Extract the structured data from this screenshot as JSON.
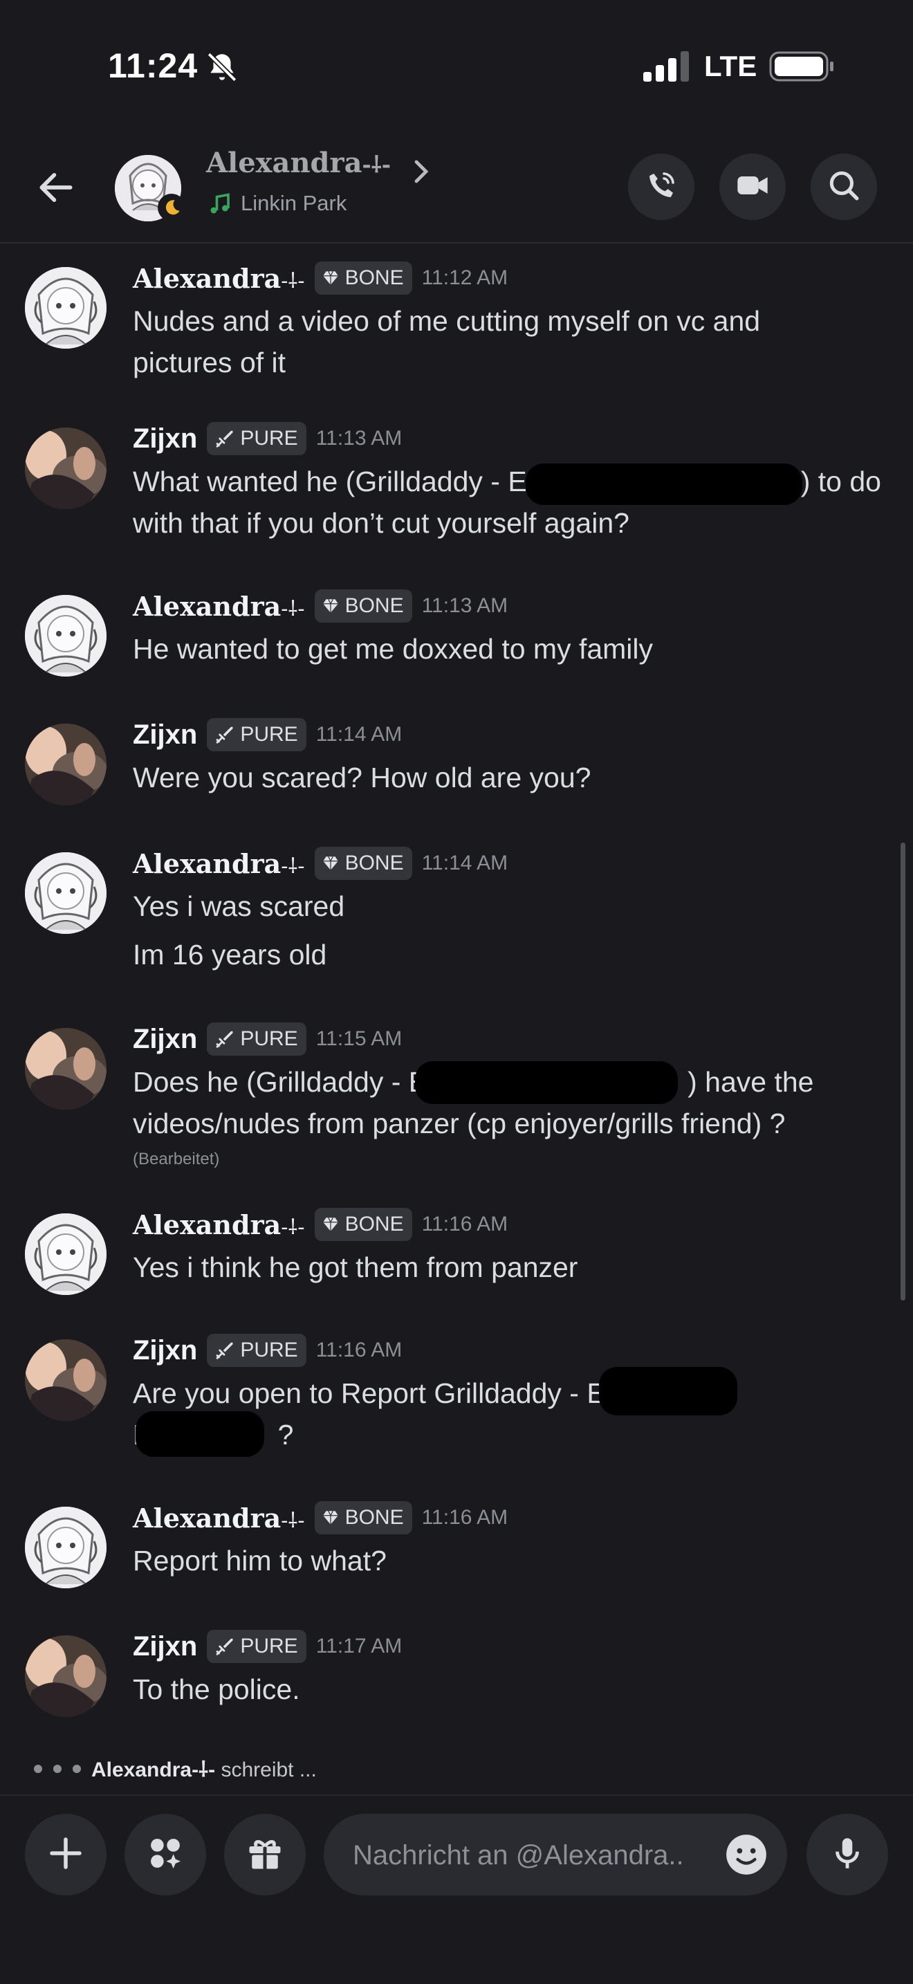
{
  "status_bar": {
    "time": "11:24",
    "network": "LTE"
  },
  "header": {
    "name": "Alexandra",
    "name_suffix": "-⸸-",
    "activity": "Linkin Park"
  },
  "messages": [
    {
      "author": "Alexandra",
      "suffix": "-⸸-",
      "badge": "BONE",
      "time": "11:12 AM",
      "lines": [
        "Nudes and a video of me cutting myself on vc and",
        "pictures of it"
      ]
    },
    {
      "author": "Zijxn",
      "badge": "PURE",
      "time": "11:13 AM",
      "lines": [
        "What wanted he (Grilldaddy - E",
        ") to do",
        "with that if you don’t cut yourself again?"
      ]
    },
    {
      "author": "Alexandra",
      "suffix": "-⸸-",
      "badge": "BONE",
      "time": "11:13 AM",
      "lines": [
        "He wanted to get me doxxed to my family"
      ]
    },
    {
      "author": "Zijxn",
      "badge": "PURE",
      "time": "11:14 AM",
      "lines": [
        "Were you scared? How old are you?"
      ]
    },
    {
      "author": "Alexandra",
      "suffix": "-⸸-",
      "badge": "BONE",
      "time": "11:14 AM",
      "lines": [
        "Yes i was scared",
        "Im 16 years old"
      ]
    },
    {
      "author": "Zijxn",
      "badge": "PURE",
      "time": "11:15 AM",
      "lines": [
        "Does he (Grilldaddy - E",
        ") have the",
        "videos/nudes from panzer (cp enjoyer/grills friend) ?"
      ],
      "edited": "(Bearbeitet)"
    },
    {
      "author": "Alexandra",
      "suffix": "-⸸-",
      "badge": "BONE",
      "time": "11:16 AM",
      "lines": [
        "Yes i think he got them from panzer"
      ]
    },
    {
      "author": "Zijxn",
      "badge": "PURE",
      "time": "11:16 AM",
      "lines": [
        "Are you open to Report Grilldaddy - E",
        "D",
        "?"
      ]
    },
    {
      "author": "Alexandra",
      "suffix": "-⸸-",
      "badge": "BONE",
      "time": "11:16 AM",
      "lines": [
        "Report him to what?"
      ]
    },
    {
      "author": "Zijxn",
      "badge": "PURE",
      "time": "11:17 AM",
      "lines": [
        "To the police."
      ]
    }
  ],
  "typing": {
    "user": "Alexandra-⸸-",
    "text": "schreibt ..."
  },
  "composer": {
    "placeholder": "Nachricht an @Alexandra.."
  },
  "icons": {
    "back": "arrow-left-icon",
    "call": "phone-icon",
    "video": "video-camera-icon",
    "search": "search-icon",
    "add": "plus-icon",
    "apps": "apps-icon",
    "gift": "gift-icon",
    "emoji": "emoji-icon",
    "mic": "microphone-icon",
    "badge_bone": "gem-icon",
    "badge_pure": "sword-icon",
    "activity": "music-note-icon"
  },
  "colors": {
    "background": "#1a1a1e",
    "activity_green": "#3ba55d",
    "badge": "#33353b"
  }
}
